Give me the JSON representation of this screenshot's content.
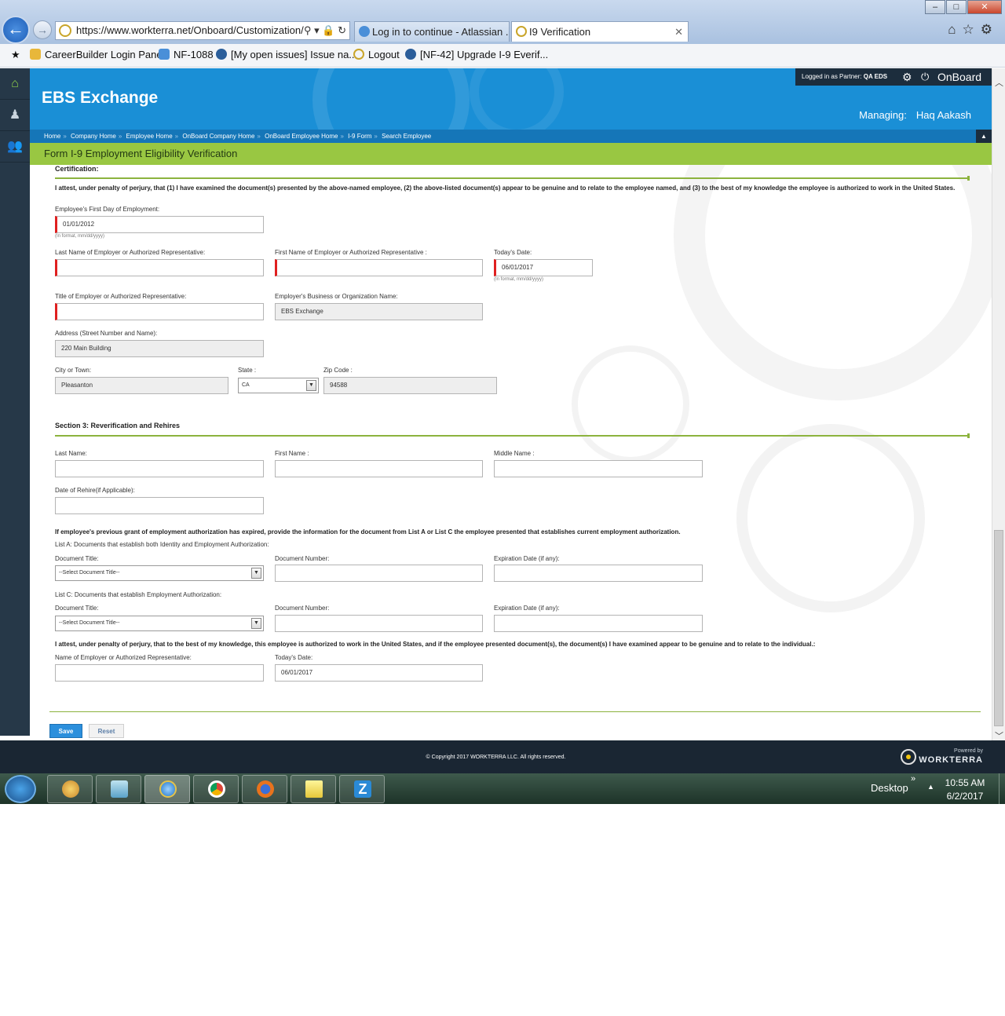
{
  "browser": {
    "address": "https://www.workterra.net/Onboard/Customization/",
    "tabs": [
      {
        "label": "Log in to continue - Atlassian ..."
      },
      {
        "label": "I9 Verification"
      }
    ],
    "favorites": [
      "CareerBuilder Login Panel",
      "NF-1088",
      "[My open issues] Issue na...",
      "Logout",
      "[NF-42] Upgrade I-9 Everif..."
    ]
  },
  "app": {
    "brand": "EBS Exchange",
    "logged_in_label": "Logged in as Partner:",
    "logged_in_value": "QA EDS",
    "onboard_label": "OnBoard",
    "managing_label": "Managing:",
    "managing_value": "Haq Aakash",
    "breadcrumb": [
      "Home",
      "Company Home",
      "Employee Home",
      "OnBoard Company Home",
      "OnBoard Employee Home",
      "I-9 Form",
      "Search Employee"
    ],
    "page_title": "Form I-9 Employment Eligibility Verification"
  },
  "certification": {
    "heading": "Certification:",
    "attest_text": "I attest, under penalty of perjury, that (1) I have examined the document(s) presented by the above-named employee, (2) the above-listed document(s) appear to be genuine and to relate to the employee named, and (3) to the best of my knowledge the employee is authorized to work in the United States.",
    "first_day_label": "Employee's First Day of Employment:",
    "first_day_value": "01/01/2012",
    "format_hint": "(In format, mm/dd/yyyy)",
    "last_name_label": "Last Name of Employer or Authorized Representative:",
    "first_name_label": "First Name of Employer or Authorized Representative :",
    "todays_date_label": "Today's Date:",
    "todays_date_value": "06/01/2017",
    "title_label": "Title of Employer or Authorized Representative:",
    "business_label": "Employer's Business or Organization Name:",
    "business_value": "EBS Exchange",
    "address_label": "Address (Street Number and Name):",
    "address_value": "220 Main Building",
    "city_label": "City or Town:",
    "city_value": "Pleasanton",
    "state_label": "State :",
    "state_value": "CA",
    "zip_label": "Zip Code :",
    "zip_value": "94588"
  },
  "section3": {
    "heading": "Section 3: Reverification and Rehires",
    "last_name_label": "Last Name:",
    "first_name_label": "First Name :",
    "middle_name_label": "Middle Name :",
    "rehire_label": "Date of Rehire(if Applicable):",
    "expired_text": "If employee's previous grant of employment authorization has expired, provide the information for the document from List A or List C the employee presented that establishes current employment authorization.",
    "list_a_label": "List A: Documents that establish both Identity and Employment Authorization:",
    "list_c_label": "List C: Documents that establish Employment Authorization:",
    "doc_title_label": "Document Title:",
    "doc_number_label": "Document Number:",
    "expiration_label": "Expiration Date (if any):",
    "select_placeholder": "--Select Document Title--",
    "attest_text": "I attest, under penalty of perjury, that to the best of my knowledge, this employee is authorized to work in the United States, and if the employee presented document(s), the document(s) I have examined appear to be genuine and to relate to the individual.:",
    "employer_name_label": "Name of Employer or Authorized Representative:",
    "todays_date_label": "Today's Date:",
    "todays_date_value": "06/01/2017"
  },
  "actions": {
    "save": "Save",
    "reset": "Reset"
  },
  "footer": {
    "copyright": "© Copyright 2017 WORKTERRA LLC. All rights reserved.",
    "powered_by": "Powered by",
    "workterra": "WORKTERRA"
  },
  "taskbar": {
    "desktop": "Desktop",
    "time": "10:55 AM",
    "date": "6/2/2017"
  },
  "colors": {
    "header_blue": "#1a8fd6",
    "title_green": "#99c742",
    "required_red": "#e02020",
    "save_blue": "#2b8fdc"
  }
}
